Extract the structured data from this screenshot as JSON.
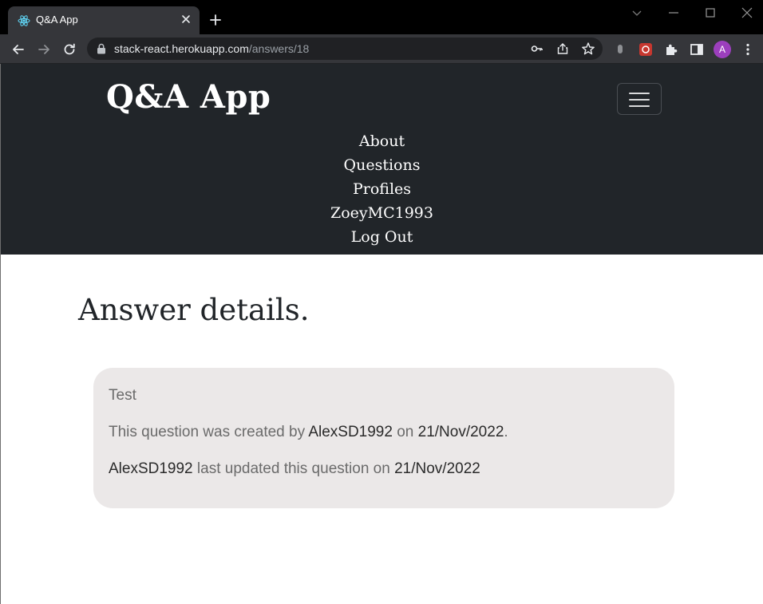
{
  "browser": {
    "tab_title": "Q&A App",
    "url_host": "stack-react.herokuapp.com",
    "url_path": "/answers/18",
    "profile_initial": "A"
  },
  "navbar": {
    "brand": "Q&A App",
    "items": [
      {
        "label": "About"
      },
      {
        "label": "Questions"
      },
      {
        "label": "Profiles"
      },
      {
        "label": "ZoeyMC1993"
      },
      {
        "label": "Log Out"
      }
    ]
  },
  "main": {
    "heading": "Answer details.",
    "card": {
      "body": "Test",
      "created_prefix": "This question was created by ",
      "created_by": "AlexSD1992",
      "created_mid": " on ",
      "created_date": "21/Nov/2022",
      "created_suffix": ".",
      "updated_by": "AlexSD1992",
      "updated_mid": " last updated this question on ",
      "updated_date": "21/Nov/2022"
    }
  }
}
